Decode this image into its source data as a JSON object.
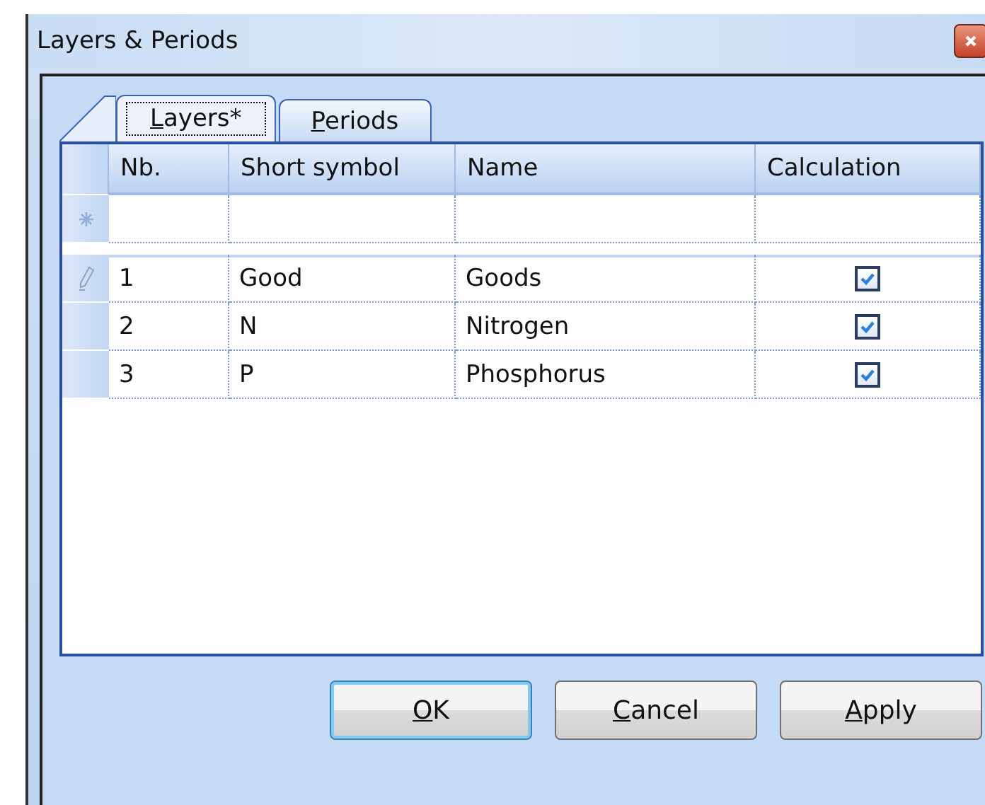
{
  "window": {
    "title": "Layers & Periods"
  },
  "tabs": [
    {
      "label": "Layers*",
      "selected": true
    },
    {
      "label": "Periods",
      "selected": false
    }
  ],
  "table": {
    "columns": [
      "Nb.",
      "Short symbol",
      "Name",
      "Calculation"
    ],
    "rows": [
      {
        "current": true,
        "nb": "1",
        "symbol": "Good",
        "name": "Goods",
        "calculation": true
      },
      {
        "current": false,
        "nb": "2",
        "symbol": "N",
        "name": "Nitrogen",
        "calculation": true
      },
      {
        "current": false,
        "nb": "3",
        "symbol": "P",
        "name": "Phosphorus",
        "calculation": true
      }
    ]
  },
  "buttons": [
    {
      "label": "OK",
      "default": true
    },
    {
      "label": "Cancel",
      "default": false
    },
    {
      "label": "Apply",
      "default": false
    }
  ]
}
